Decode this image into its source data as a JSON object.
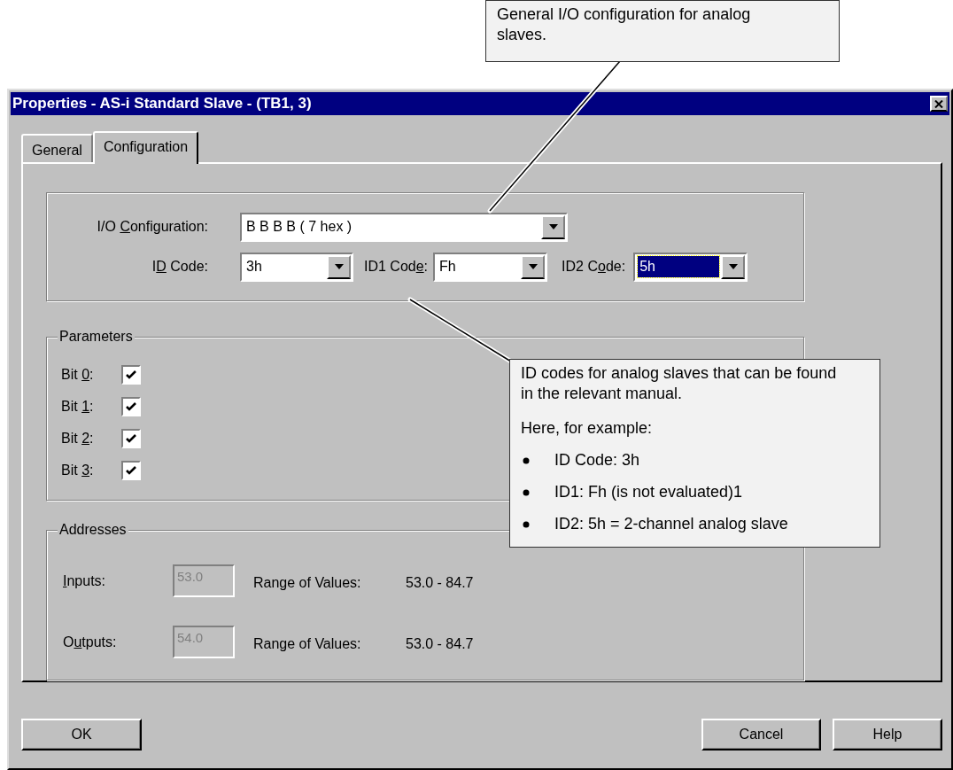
{
  "window": {
    "title": "Properties - AS-i Standard Slave - (TB1, 3)"
  },
  "tabs": [
    {
      "label": "General",
      "selected": false
    },
    {
      "label": "Configuration",
      "selected": true
    }
  ],
  "io_configuration": {
    "label": "I/O Configuration:",
    "value": "B  B  B  B ( 7 hex )"
  },
  "id_codes": [
    {
      "label": "ID Code:",
      "value": "3h",
      "focused": false
    },
    {
      "label": "ID1 Code:",
      "value": "Fh",
      "focused": false
    },
    {
      "label": "ID2 Code:",
      "value": "5h",
      "focused": true
    }
  ],
  "parameters": {
    "title": "Parameters",
    "bits": [
      {
        "label": "Bit 0:",
        "checked": true
      },
      {
        "label": "Bit 1:",
        "checked": true
      },
      {
        "label": "Bit 2:",
        "checked": true
      },
      {
        "label": "Bit 3:",
        "checked": true
      }
    ]
  },
  "addresses": {
    "title": "Addresses",
    "rows": [
      {
        "label": "Inputs:",
        "value": "53.0",
        "disabled": true,
        "range_label": "Range of Values:",
        "range": "53.0 - 84.7"
      },
      {
        "label": "Outputs:",
        "value": "54.0",
        "disabled": true,
        "range_label": "Range of Values:",
        "range": "53.0 - 84.7"
      }
    ]
  },
  "buttons": [
    {
      "label": "OK"
    },
    {
      "label": "Cancel"
    },
    {
      "label": "Help"
    }
  ],
  "callouts": [
    {
      "paragraphs": [
        "General I/O configuration for analog slaves."
      ]
    },
    {
      "paragraphs": [
        "ID codes for analog slaves that can be found in the relevant manual.",
        "Here, for example:"
      ],
      "bullets": [
        "ID Code: 3h",
        "ID1: Fh (is not evaluated)1",
        "ID2: 5h = 2-channel analog slave"
      ]
    }
  ]
}
